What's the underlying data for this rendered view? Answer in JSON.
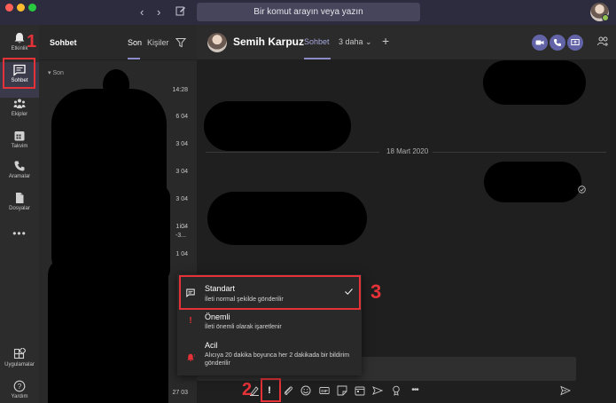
{
  "titlebar": {
    "search_placeholder": "Bir komut arayın veya yazın",
    "colors": {
      "bg": "#2d2c3e",
      "dot_red": "#fe5f57",
      "dot_yellow": "#febc2e",
      "dot_green": "#28c840"
    }
  },
  "rail": {
    "items": [
      {
        "label": "Etkinlik",
        "icon": "bell-icon"
      },
      {
        "label": "Sohbet",
        "icon": "chat-icon",
        "active": true
      },
      {
        "label": "Ekipler",
        "icon": "teams-icon"
      },
      {
        "label": "Takvim",
        "icon": "calendar-icon"
      },
      {
        "label": "Aramalar",
        "icon": "phone-icon"
      },
      {
        "label": "Dosyalar",
        "icon": "file-icon"
      },
      {
        "label": "Uygulamalar",
        "icon": "apps-icon"
      },
      {
        "label": "Yardım",
        "icon": "help-icon"
      }
    ]
  },
  "chatlist": {
    "title": "Sohbet",
    "tabs": [
      "Son",
      "Kişiler"
    ],
    "section": "Son",
    "times": [
      "14:28",
      "6 04",
      "3 04",
      "3 04",
      "3 04",
      "1 04",
      "1 04",
      "31",
      "30",
      "30",
      "27 03"
    ],
    "fragments": [
      "i...",
      "-3..."
    ]
  },
  "chat": {
    "name": "Semih Karpuz",
    "tab": "Sohbet",
    "more": "3 daha",
    "date_separator": "18 Mart 2020",
    "accent": "#6264a7"
  },
  "priority": {
    "options": [
      {
        "title": "Standart",
        "desc": "İleti normal şekilde gönderilir",
        "selected": true
      },
      {
        "title": "Önemli",
        "desc": "İleti önemli olarak işaretlenir"
      },
      {
        "title": "Acil",
        "desc": "Alıcıya 20 dakika boyunca her 2 dakikada bir bildirim gönderilir"
      }
    ]
  },
  "annotations": [
    "1",
    "2",
    "3"
  ],
  "annotation_color": "#e53238"
}
